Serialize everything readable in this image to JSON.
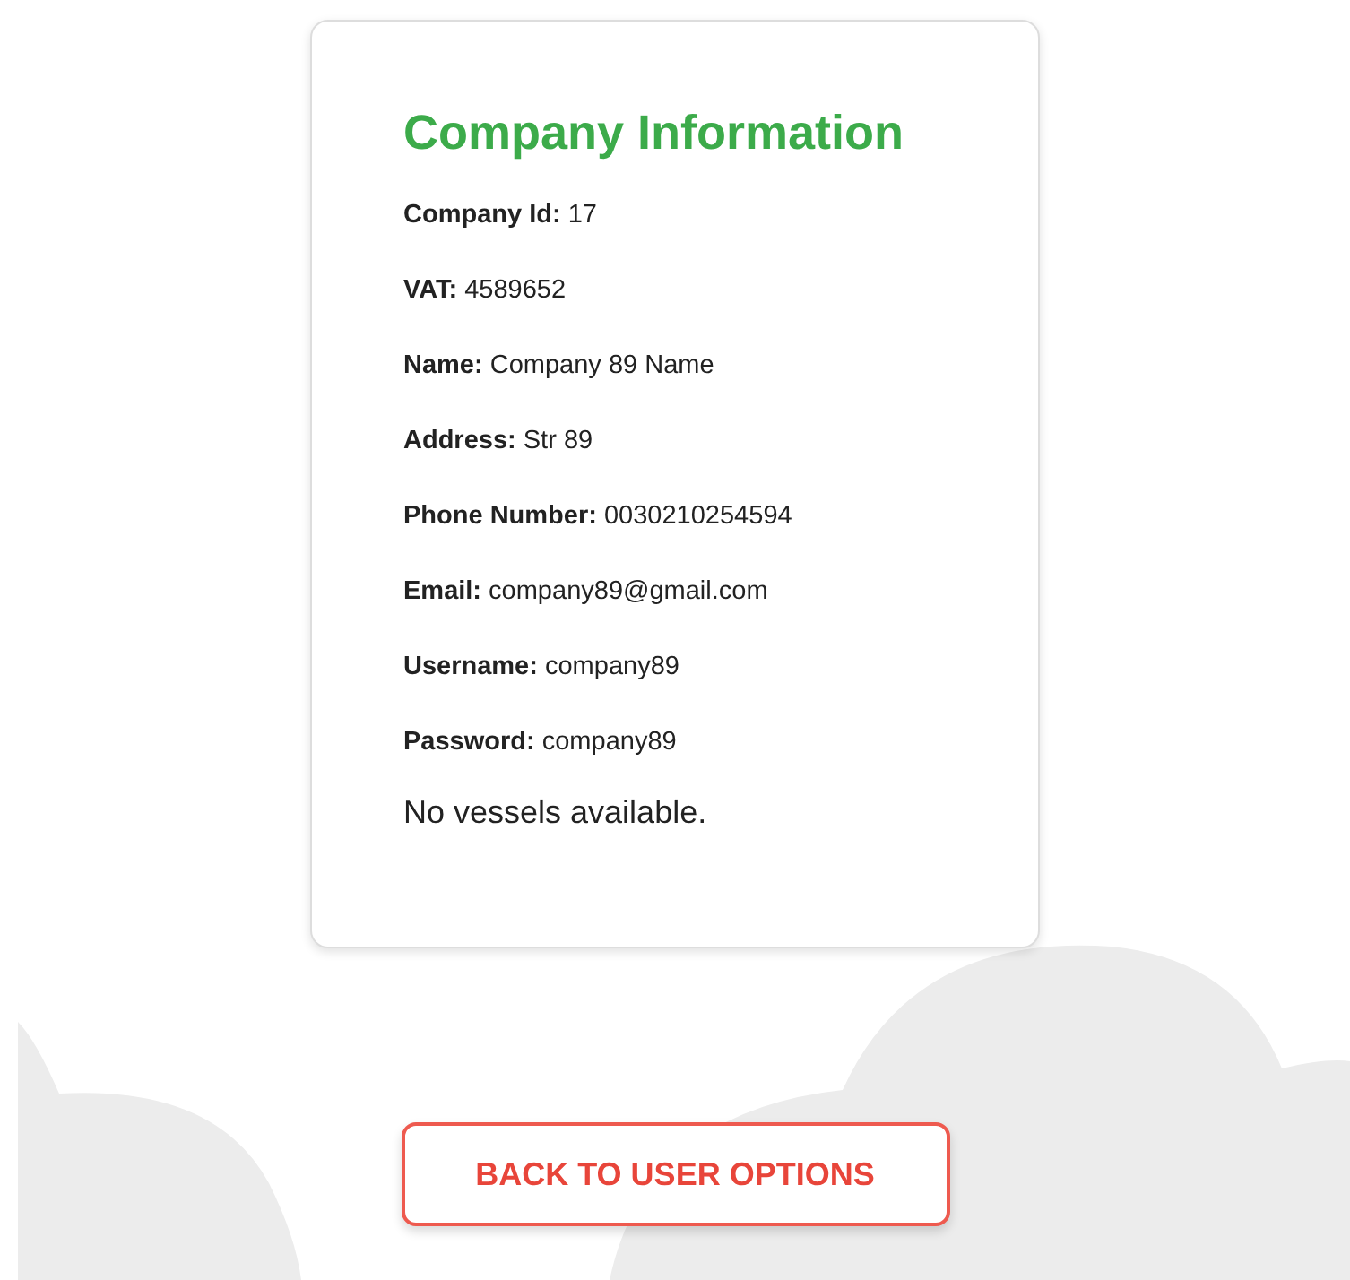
{
  "card": {
    "title": "Company Information",
    "fields": [
      {
        "text": "**Company Id:** 17"
      },
      {
        "text": "**VAT:** 4589652"
      },
      {
        "text": "**Name:** Company 89 Name"
      },
      {
        "text": "**Address:** Str 89"
      },
      {
        "text": "**Phone Number:** 0030210254594"
      },
      {
        "text": "**Email:** company89@gmail.com"
      },
      {
        "text": "**Username:** company89"
      },
      {
        "text": "**Password:** company89"
      }
    ],
    "note": "No vessels available."
  },
  "button": {
    "label": "BACK TO USER OPTIONS"
  }
}
